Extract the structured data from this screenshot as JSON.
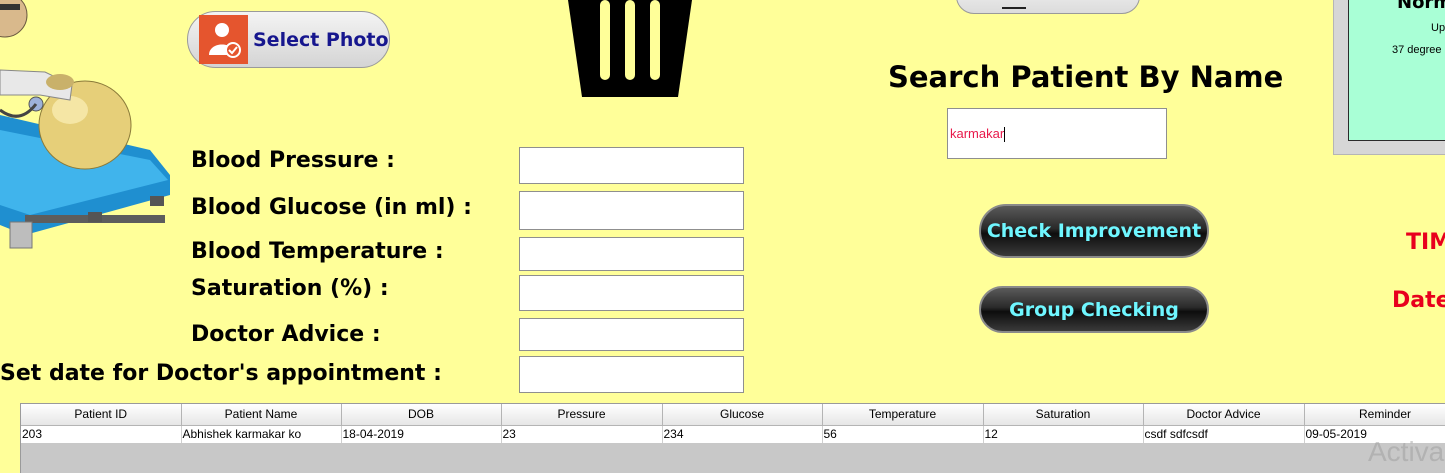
{
  "select_photo": {
    "label": "Select Photo",
    "icon": "user-photo-icon"
  },
  "trash": {
    "icon": "trash-icon"
  },
  "search": {
    "title": "Search Patient By Name",
    "value": "karmakar"
  },
  "buttons": {
    "check_improvement": "Check Improvement",
    "group_checking": "Group Checking"
  },
  "info_panel": {
    "title": "Norm",
    "line1": "Up",
    "line2": "37 degree"
  },
  "side_labels": {
    "time": "TIM",
    "date": "Date"
  },
  "form": {
    "fields": [
      {
        "label": "Blood Pressure :",
        "value": ""
      },
      {
        "label": "Blood Glucose (in ml) :",
        "value": ""
      },
      {
        "label": "Blood Temperature :",
        "value": ""
      },
      {
        "label": "Saturation (%) :",
        "value": ""
      },
      {
        "label": "Doctor Advice :",
        "value": ""
      },
      {
        "label": "Set date for Doctor's appointment :",
        "value": ""
      }
    ]
  },
  "table": {
    "columns": [
      "Patient ID",
      "Patient Name",
      "DOB",
      "Pressure",
      "Glucose",
      "Temperature",
      "Saturation",
      "Doctor Advice",
      "Reminder"
    ],
    "rows": [
      [
        "203",
        "Abhishek karmakar ko",
        "18-04-2019",
        "23",
        "234",
        "56",
        "12",
        "csdf  sdfcsdf",
        "09-05-2019"
      ]
    ]
  },
  "watermark": "Activa",
  "colors": {
    "background": "#ffff99",
    "accent_red": "#e8001d",
    "button_text": "#6ff6ff",
    "panel_green": "#a9ffd6"
  }
}
